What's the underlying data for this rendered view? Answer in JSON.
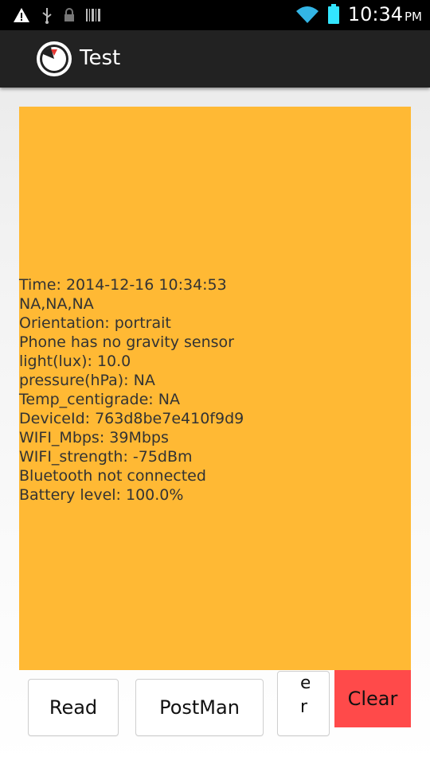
{
  "status_bar": {
    "time": "10:34",
    "ampm": "PM",
    "icons": [
      "warning-icon",
      "usb-icon",
      "lock-icon",
      "barcode-icon",
      "wifi-icon",
      "battery-icon"
    ]
  },
  "action_bar": {
    "title": "Test",
    "icon": "gauge-icon"
  },
  "panel": {
    "background": "#ffb934",
    "lines": [
      "Time: 2014-12-16 10:34:53",
      "NA,NA,NA",
      "Orientation: portrait",
      "Phone has no gravity sensor",
      "light(lux): 10.0",
      "pressure(hPa): NA",
      "Temp_centigrade: NA",
      "DeviceId: 763d8be7e410f9d9",
      "WIFI_Mbps: 39Mbps",
      "WIFI_strength: -75dBm",
      "Bluetooth not connected",
      "Battery level: 100.0%"
    ]
  },
  "buttons": {
    "read": "Read",
    "postman": "PostMan",
    "narrow_top": "e",
    "narrow_bottom": "r",
    "clear": "Clear"
  },
  "colors": {
    "clear_button": "#ff4a4a",
    "action_bar": "#222222"
  }
}
